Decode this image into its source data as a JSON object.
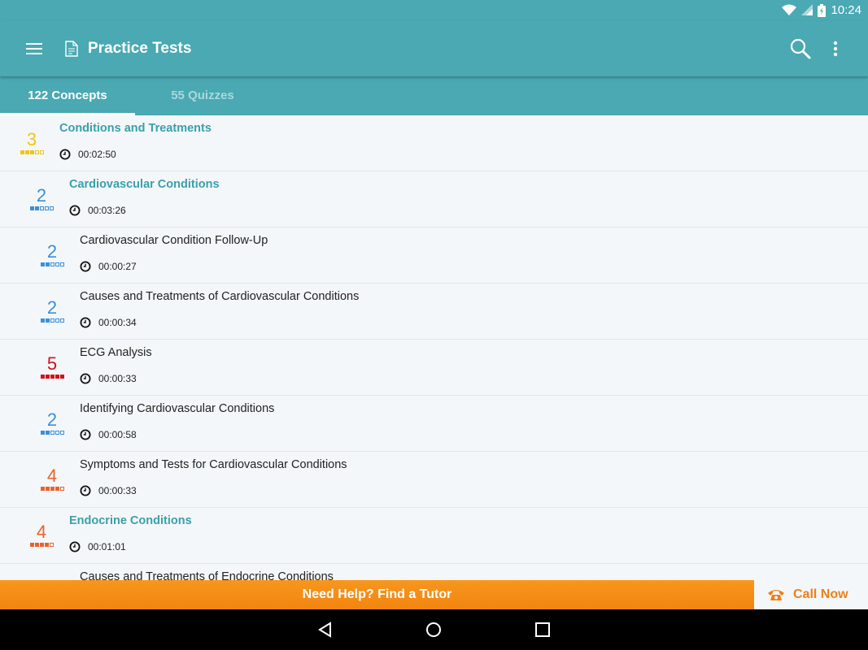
{
  "status": {
    "time": "10:24"
  },
  "appbar": {
    "title": "Practice Tests"
  },
  "tabs": [
    {
      "label": "122 Concepts",
      "active": true
    },
    {
      "label": "55 Quizzes",
      "active": false
    }
  ],
  "colors": {
    "primary": "#4aa9b2",
    "section_title": "#3aa0ab",
    "accent": "#f28510",
    "level_3": "#f2c511",
    "level_2": "#3b8fd9",
    "level_5": "#d0121b",
    "level_4": "#e8622c"
  },
  "items": [
    {
      "score": "3",
      "filled": 3,
      "color": "#f2c511",
      "title": "Conditions and Treatments",
      "time": "00:02:50",
      "level": 0,
      "section": true
    },
    {
      "score": "2",
      "filled": 2,
      "color": "#3b8fd9",
      "title": "Cardiovascular Conditions",
      "time": "00:03:26",
      "level": 1,
      "section": true
    },
    {
      "score": "2",
      "filled": 2,
      "color": "#3b8fd9",
      "title": "Cardiovascular Condition Follow-Up",
      "time": "00:00:27",
      "level": 2,
      "section": false
    },
    {
      "score": "2",
      "filled": 2,
      "color": "#3b8fd9",
      "title": "Causes and Treatments of Cardiovascular Conditions",
      "time": "00:00:34",
      "level": 2,
      "section": false
    },
    {
      "score": "5",
      "filled": 5,
      "color": "#d0121b",
      "title": "ECG Analysis",
      "time": "00:00:33",
      "level": 2,
      "section": false
    },
    {
      "score": "2",
      "filled": 2,
      "color": "#3b8fd9",
      "title": "Identifying Cardiovascular Conditions",
      "time": "00:00:58",
      "level": 2,
      "section": false
    },
    {
      "score": "4",
      "filled": 4,
      "color": "#e8622c",
      "title": "Symptoms and Tests for Cardiovascular Conditions",
      "time": "00:00:33",
      "level": 2,
      "section": false
    },
    {
      "score": "4",
      "filled": 4,
      "color": "#e8622c",
      "title": "Endocrine Conditions",
      "time": "00:01:01",
      "level": 1,
      "section": true
    },
    {
      "score": "",
      "filled": 0,
      "color": "#3b8fd9",
      "title": "Causes and Treatments of Endocrine Conditions",
      "time": "",
      "level": 2,
      "section": false
    }
  ],
  "banner": {
    "label": "Need Help? Find a Tutor"
  },
  "callnow": {
    "label": "Call Now"
  }
}
